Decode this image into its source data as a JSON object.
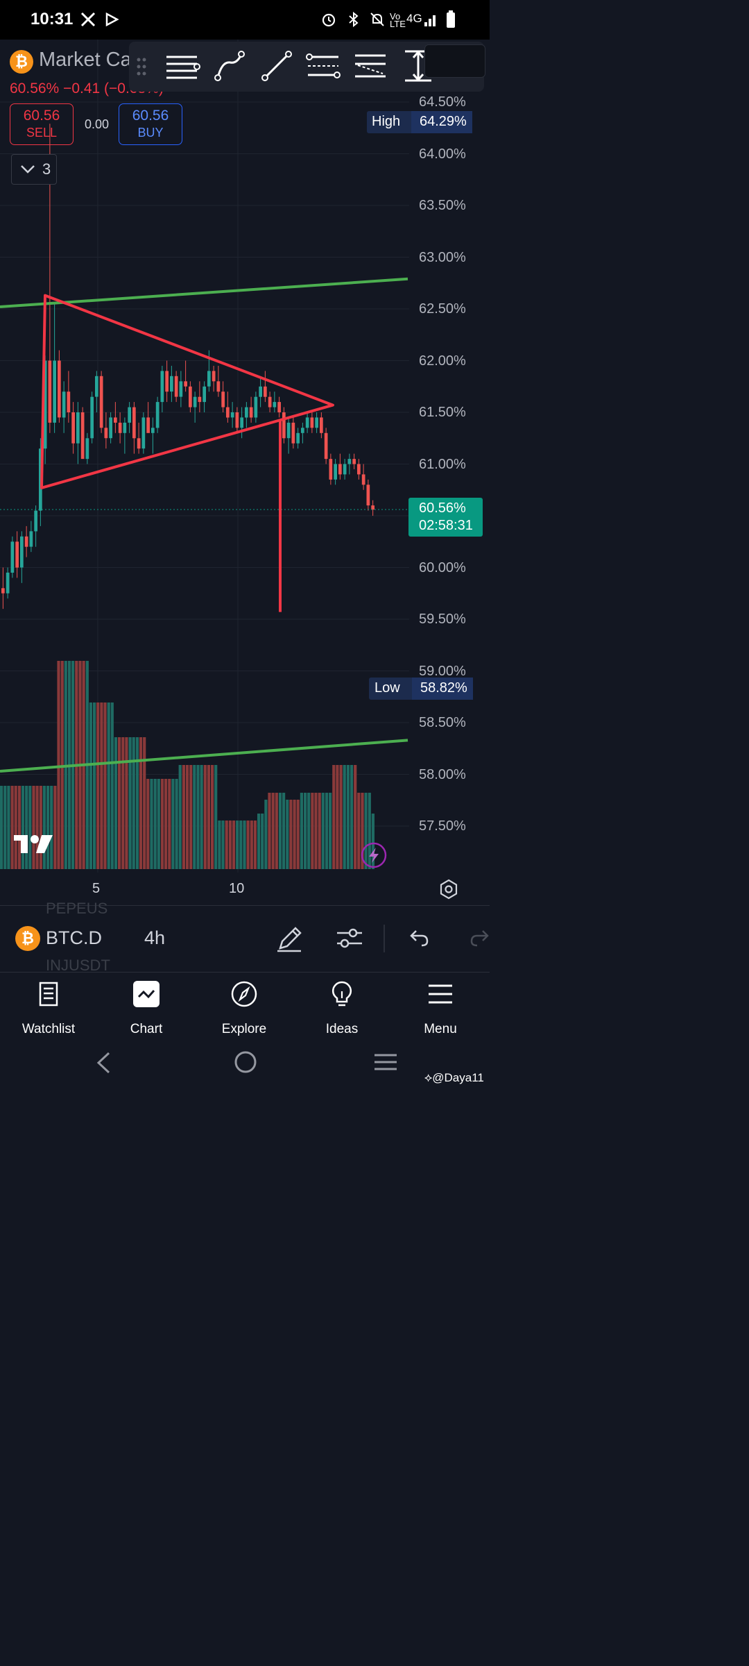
{
  "status_bar": {
    "time": "10:31",
    "right_icons": "⏰ ✱ 🔕 Vo LTE 4G ▮"
  },
  "legend": {
    "symbol_name": "Market Ca",
    "change": "60.56% −0.41 (−0.68%)",
    "sell_price": "60.56",
    "sell_label": "SELL",
    "spread": "0.00",
    "buy_price": "60.56",
    "buy_label": "BUY",
    "indicator_count": "3"
  },
  "drawing_toolbar": [
    "horizontal-lines-tool",
    "curve-tool",
    "trend-line-tool",
    "parallel-channel-tool",
    "regression-channel-tool",
    "measure-tool"
  ],
  "price_axis": {
    "labels": [
      "64.50%",
      "64.00%",
      "63.50%",
      "63.00%",
      "62.50%",
      "62.00%",
      "61.50%",
      "61.00%",
      "60.00%",
      "59.50%",
      "59.00%",
      "58.50%",
      "58.00%",
      "57.50%"
    ],
    "high_label": "High",
    "high_value": "64.29%",
    "low_label": "Low",
    "low_value": "58.82%",
    "current_price": "60.56%",
    "countdown": "02:58:31"
  },
  "time_axis": {
    "labels": [
      "5",
      "10"
    ]
  },
  "colors": {
    "up": "#26a69a",
    "down": "#ef5350",
    "drawing_red": "#f23645",
    "drawing_green": "#4caf50",
    "background": "#131722"
  },
  "bottom_toolbar": {
    "symbol": "BTC.D",
    "interval": "4h",
    "ghost_above": "PEPEUS",
    "ghost_below": "INJUSDT"
  },
  "nav": [
    {
      "label": "Watchlist",
      "icon": "watchlist-icon"
    },
    {
      "label": "Chart",
      "icon": "chart-icon"
    },
    {
      "label": "Explore",
      "icon": "compass-icon"
    },
    {
      "label": "Ideas",
      "icon": "lightbulb-icon"
    },
    {
      "label": "Menu",
      "icon": "menu-icon"
    }
  ],
  "watermark": "@Daya11",
  "chart_data": {
    "type": "candlestick",
    "interval": "4h",
    "current": 60.56,
    "high": 64.29,
    "low": 58.82,
    "price_range": [
      57.2,
      64.8
    ],
    "candles": [
      [
        59.8,
        60.0,
        59.6,
        59.75
      ],
      [
        59.75,
        60.0,
        59.7,
        59.95
      ],
      [
        59.95,
        60.3,
        59.9,
        60.25
      ],
      [
        60.25,
        60.35,
        59.9,
        60.0
      ],
      [
        60.0,
        60.35,
        59.85,
        60.3
      ],
      [
        60.3,
        60.4,
        60.1,
        60.2
      ],
      [
        60.2,
        60.45,
        60.15,
        60.35
      ],
      [
        60.35,
        60.6,
        60.2,
        60.55
      ],
      [
        60.55,
        61.25,
        60.4,
        61.15
      ],
      [
        61.15,
        62.05,
        61.0,
        62.0
      ],
      [
        62.0,
        64.29,
        61.3,
        61.4
      ],
      [
        61.4,
        62.55,
        61.3,
        62.0
      ],
      [
        62.0,
        62.1,
        61.4,
        61.45
      ],
      [
        61.45,
        61.8,
        61.3,
        61.7
      ],
      [
        61.7,
        61.9,
        61.4,
        61.5
      ],
      [
        61.5,
        61.6,
        61.1,
        61.2
      ],
      [
        61.2,
        61.6,
        61.0,
        61.5
      ],
      [
        61.5,
        61.55,
        61.05,
        61.05
      ],
      [
        61.05,
        61.3,
        61.0,
        61.25
      ],
      [
        61.25,
        61.7,
        61.2,
        61.65
      ],
      [
        61.65,
        61.9,
        61.5,
        61.85
      ],
      [
        61.85,
        61.9,
        61.3,
        61.35
      ],
      [
        61.35,
        61.5,
        61.15,
        61.25
      ],
      [
        61.25,
        61.5,
        61.2,
        61.45
      ],
      [
        61.45,
        61.6,
        61.3,
        61.4
      ],
      [
        61.4,
        61.5,
        61.2,
        61.3
      ],
      [
        61.3,
        61.45,
        61.1,
        61.4
      ],
      [
        61.4,
        61.6,
        61.3,
        61.55
      ],
      [
        61.55,
        61.6,
        61.1,
        61.25
      ],
      [
        61.25,
        61.4,
        61.1,
        61.15
      ],
      [
        61.15,
        61.5,
        61.1,
        61.45
      ],
      [
        61.45,
        61.6,
        61.35,
        61.3
      ],
      [
        61.3,
        61.45,
        61.1,
        61.35
      ],
      [
        61.35,
        61.65,
        61.3,
        61.6
      ],
      [
        61.6,
        61.95,
        61.5,
        61.9
      ],
      [
        61.9,
        62.0,
        61.6,
        61.7
      ],
      [
        61.7,
        61.95,
        61.6,
        61.85
      ],
      [
        61.85,
        61.9,
        61.6,
        61.65
      ],
      [
        61.65,
        61.9,
        61.55,
        61.8
      ],
      [
        61.8,
        62.0,
        61.7,
        61.75
      ],
      [
        61.75,
        61.8,
        61.5,
        61.55
      ],
      [
        61.55,
        61.7,
        61.4,
        61.65
      ],
      [
        61.65,
        61.8,
        61.5,
        61.6
      ],
      [
        61.6,
        61.8,
        61.5,
        61.75
      ],
      [
        61.75,
        62.1,
        61.7,
        61.9
      ],
      [
        61.9,
        61.95,
        61.7,
        61.8
      ],
      [
        61.8,
        61.95,
        61.65,
        61.7
      ],
      [
        61.7,
        61.8,
        61.5,
        61.55
      ],
      [
        61.55,
        61.7,
        61.4,
        61.45
      ],
      [
        61.45,
        61.6,
        61.35,
        61.5
      ],
      [
        61.5,
        61.55,
        61.3,
        61.35
      ],
      [
        61.35,
        61.55,
        61.25,
        61.45
      ],
      [
        61.45,
        61.6,
        61.35,
        61.55
      ],
      [
        61.55,
        61.65,
        61.4,
        61.45
      ],
      [
        61.45,
        61.7,
        61.4,
        61.65
      ],
      [
        61.65,
        61.85,
        61.55,
        61.75
      ],
      [
        61.75,
        61.9,
        61.6,
        61.65
      ],
      [
        61.65,
        61.7,
        61.5,
        61.55
      ],
      [
        61.55,
        61.7,
        61.5,
        61.6
      ],
      [
        61.6,
        61.65,
        61.45,
        61.5
      ],
      [
        61.5,
        61.55,
        61.2,
        61.25
      ],
      [
        61.25,
        61.45,
        61.1,
        61.4
      ],
      [
        61.4,
        61.45,
        61.15,
        61.2
      ],
      [
        61.2,
        61.35,
        61.15,
        61.3
      ],
      [
        61.3,
        61.4,
        61.2,
        61.35
      ],
      [
        61.35,
        61.5,
        61.3,
        61.45
      ],
      [
        61.45,
        61.5,
        61.3,
        61.35
      ],
      [
        61.35,
        61.5,
        61.3,
        61.45
      ],
      [
        61.45,
        61.5,
        61.25,
        61.3
      ],
      [
        61.3,
        61.35,
        61.0,
        61.05
      ],
      [
        61.05,
        61.1,
        60.8,
        60.85
      ],
      [
        60.85,
        61.05,
        60.8,
        61.0
      ],
      [
        61.0,
        61.1,
        60.85,
        60.9
      ],
      [
        60.9,
        61.05,
        60.85,
        61.0
      ],
      [
        61.0,
        61.1,
        60.9,
        61.05
      ],
      [
        61.05,
        61.1,
        60.95,
        61.0
      ],
      [
        61.0,
        61.05,
        60.85,
        60.9
      ],
      [
        60.9,
        61.0,
        60.75,
        60.8
      ],
      [
        60.8,
        60.85,
        60.55,
        60.6
      ],
      [
        60.6,
        60.65,
        60.5,
        60.56
      ]
    ],
    "volumes": [
      0.12,
      0.12,
      0.12,
      0.12,
      0.12,
      0.12,
      0.12,
      0.12,
      0.12,
      0.12,
      0.12,
      0.12,
      0.12,
      0.12,
      0.12,
      0.12,
      0.3,
      0.3,
      0.3,
      0.3,
      0.3,
      0.3,
      0.3,
      0.3,
      0.3,
      0.24,
      0.24,
      0.24,
      0.24,
      0.24,
      0.24,
      0.24,
      0.19,
      0.19,
      0.19,
      0.19,
      0.19,
      0.19,
      0.19,
      0.19,
      0.19,
      0.13,
      0.13,
      0.13,
      0.13,
      0.13,
      0.13,
      0.13,
      0.13,
      0.13,
      0.15,
      0.15,
      0.15,
      0.15,
      0.15,
      0.15,
      0.15,
      0.15,
      0.15,
      0.15,
      0.15,
      0.07,
      0.07,
      0.07,
      0.07,
      0.07,
      0.07,
      0.07,
      0.07,
      0.07,
      0.07,
      0.07,
      0.08,
      0.08,
      0.1,
      0.11,
      0.11,
      0.11,
      0.11,
      0.11,
      0.1,
      0.1,
      0.1,
      0.1,
      0.11,
      0.11,
      0.11,
      0.11,
      0.11,
      0.11,
      0.11,
      0.11,
      0.11,
      0.15,
      0.15,
      0.15,
      0.15,
      0.15,
      0.15,
      0.15,
      0.11,
      0.11,
      0.11,
      0.11,
      0.08
    ]
  }
}
